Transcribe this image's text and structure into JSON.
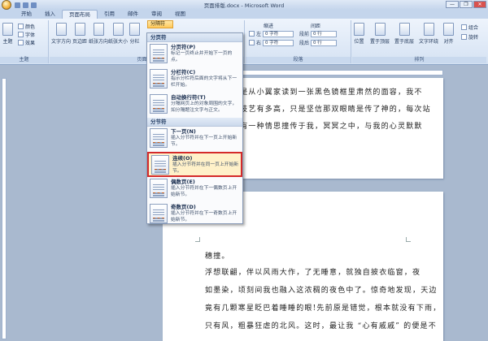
{
  "window": {
    "title": "页面排版.docx - Microsoft Word",
    "controls": [
      "—",
      "❐",
      "✕"
    ]
  },
  "tabs": [
    "开始",
    "插入",
    "页面布局",
    "引用",
    "邮件",
    "审阅",
    "视图"
  ],
  "ribbon": {
    "theme_group": {
      "main": "主题",
      "colors": "颜色",
      "fonts": "字体",
      "effects": "效果",
      "label": "主题"
    },
    "page_setup": {
      "text_direction": "文字方向",
      "margins": "页边距",
      "orientation": "纸张方向",
      "size": "纸张大小",
      "columns": "分栏",
      "breaks_button": "分隔符",
      "label": "页面设置"
    },
    "paragraph": {
      "indent_label": "缩进",
      "spacing_label": "间距",
      "left": "左",
      "right": "右",
      "before": "段前",
      "after": "段后",
      "indent_left_value": "0 字符",
      "indent_right_value": "0 字符",
      "before_value": "0 行",
      "after_value": "0 行",
      "label": "段落"
    },
    "arrange": {
      "position": "位置",
      "front": "置于顶层",
      "back": "置于底层",
      "wrap": "文字环绕",
      "align": "对齐",
      "group": "组合",
      "rotate": "旋转",
      "label": "排列"
    }
  },
  "menu": {
    "section_page_breaks": "分页符",
    "section_section_breaks": "分节符",
    "items": [
      {
        "title": "分页符(P)",
        "desc": "标记一页终止并开始下一页的点。"
      },
      {
        "title": "分栏符(C)",
        "desc": "指示分栏符后面的文字将从下一栏开始。"
      },
      {
        "title": "自动换行符(T)",
        "desc": "分隔网页上的对象周围的文字，如分隔题注文字与正文。"
      },
      {
        "title": "下一页(N)",
        "desc": "插入分节符并在下一页上开始新节。"
      },
      {
        "title": "连续(O)",
        "desc": "插入分节符并在同一页上开始新节。"
      },
      {
        "title": "偶数页(E)",
        "desc": "插入分节符并在下一偶数页上开始新节。"
      },
      {
        "title": "奇数页(D)",
        "desc": "插入分节符并在下一奇数页上开始新节。"
      }
    ]
  },
  "document": {
    "page1_lines": [
      "只是从小翼家读到一张黑色镜框里肃然的面容，我不",
      "的技艺有多高，只是坚信那双眼睛是传了神的，每次站",
      "总有一种情思撞传于我，冥冥之中，与我的心灵默默"
    ],
    "page2_lines": [
      "穗撞。",
      "浮想联翩，伴以风雨大作，了无睡意，就独自披衣临窗，夜",
      "如墨染，顷刻间我也融入这浓稠的夜色中了。惊奇地发现，天边",
      "竟有几颗寒星眨巴着睡睡的眼!先前原是错觉，根本就没有下雨，",
      "只有风，粗暴狂虐的北风。这时，最让我 “心有戚戚” 的便是不"
    ]
  }
}
